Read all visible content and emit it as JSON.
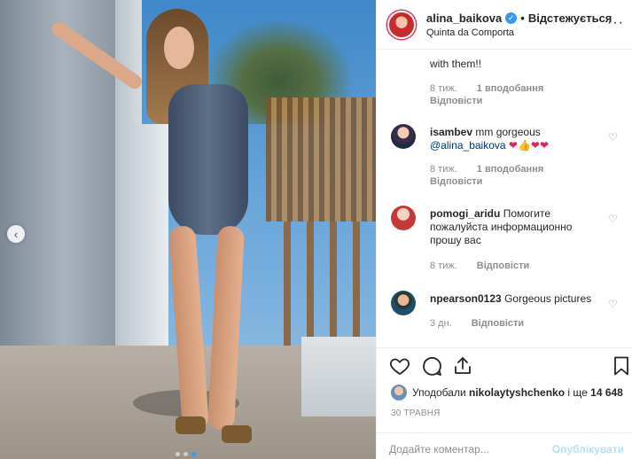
{
  "header": {
    "username": "alina_baikova",
    "follow_status": "Відстежується",
    "location": "Quinta da Comporta",
    "separator": "•"
  },
  "comments": [
    {
      "text": "with them!!",
      "age": "8 тиж.",
      "likes": "1 вподобання",
      "reply": "Відповісти"
    },
    {
      "user": "isambev",
      "text": "mm gorgeous",
      "mention": "@alina_baikova",
      "emojis": "❤👍❤❤",
      "age": "8 тиж.",
      "likes": "1 вподобання",
      "reply": "Відповісти"
    },
    {
      "user": "pomogi_aridu",
      "text_line1": "Помогите",
      "text_line2": "пожалуйста информационно",
      "text_line3": "прошу вас",
      "age": "8 тиж.",
      "reply": "Відповісти"
    },
    {
      "user": "npearson0123",
      "text": "Gorgeous pictures",
      "age": "3 дн.",
      "reply": "Відповісти"
    }
  ],
  "likes": {
    "prefix": "Уподобали",
    "user": "nikolaytyshchenko",
    "middle": "і ще",
    "count": "14 648"
  },
  "date": "30 ТРАВНЯ",
  "add_comment": {
    "placeholder": "Додайте коментар...",
    "post_label": "Опублікувати"
  },
  "colors": {
    "accent": "#3897f0",
    "muted": "#8e8e8e",
    "post_disabled": "#b2dffc"
  },
  "icons": [
    "verified-icon",
    "more-options-icon",
    "heart-icon",
    "comment-icon",
    "share-icon",
    "bookmark-icon",
    "chevron-left-icon"
  ]
}
